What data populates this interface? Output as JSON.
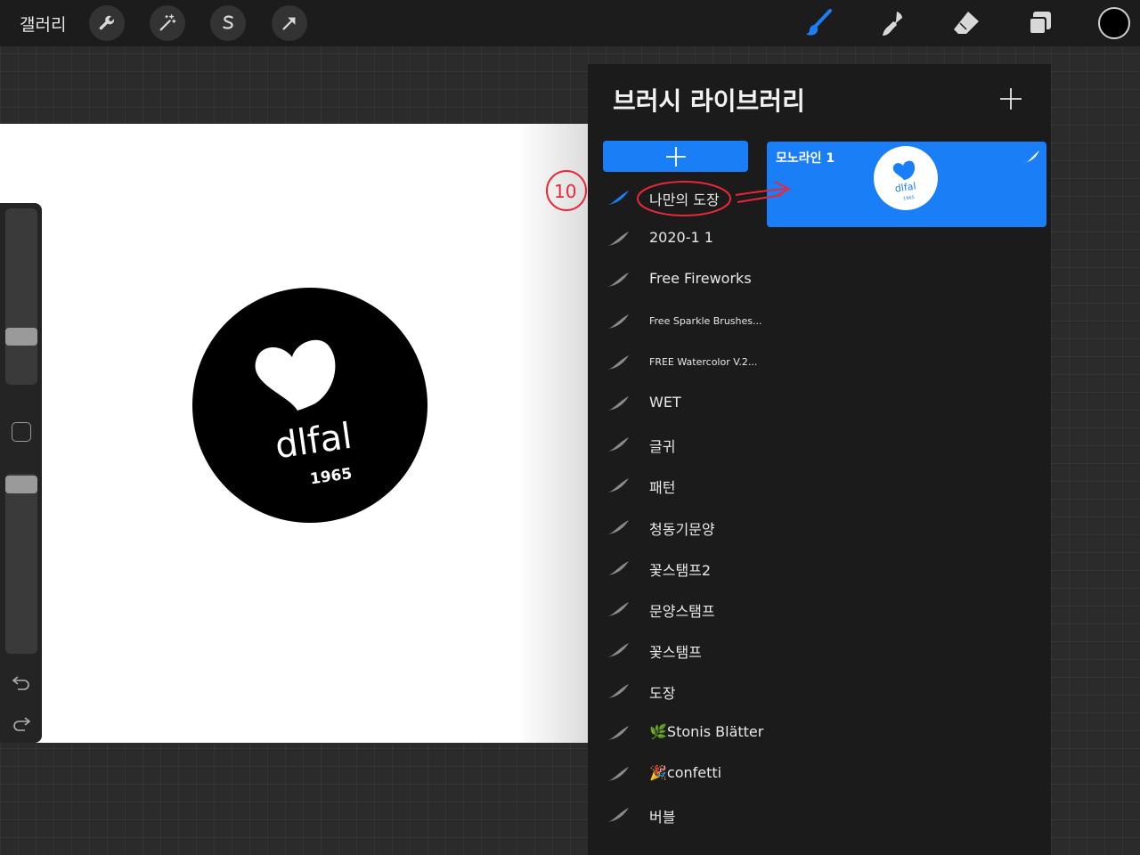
{
  "toolbar": {
    "gallery_label": "갤러리",
    "left_tools": [
      "wrench-icon",
      "magic-wand-icon",
      "selection-s-icon",
      "transform-arrow-icon"
    ],
    "right_tools": [
      "brush-icon",
      "smudge-icon",
      "eraser-icon",
      "layers-icon"
    ],
    "active_tool": "brush-icon",
    "current_color": "#000000",
    "accent_color": "#1a7ef7"
  },
  "canvas": {
    "logo_text": "dlfal",
    "logo_year": "1965"
  },
  "panel": {
    "title": "브러시 라이브러리",
    "add_icon": "plus-icon",
    "selected_brush": {
      "name": "모노라인 1"
    },
    "sets": [
      {
        "label": "나만의 도장",
        "active": true
      },
      {
        "label": "2020-1 1"
      },
      {
        "label": "Free Fireworks"
      },
      {
        "label": "Free Sparkle Brushes..."
      },
      {
        "label": "FREE Watercolor V.2..."
      },
      {
        "label": "WET"
      },
      {
        "label": "글귀"
      },
      {
        "label": "패턴"
      },
      {
        "label": "청동기문양"
      },
      {
        "label": "꽃스탬프2"
      },
      {
        "label": "문양스탬프"
      },
      {
        "label": "꽃스탬프"
      },
      {
        "label": "도장"
      },
      {
        "label": "🌿Stonis Blätter"
      },
      {
        "label": "🎉confetti"
      },
      {
        "label": "버블"
      }
    ]
  },
  "annotation": {
    "step_number": "10"
  }
}
